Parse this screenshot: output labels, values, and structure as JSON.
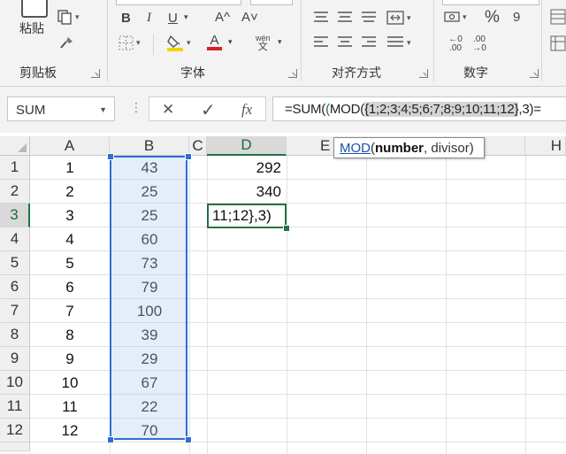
{
  "ribbon": {
    "clipboard_label": "剪贴板",
    "paste_label": "粘贴",
    "font_group_label": "字体",
    "alignment_group_label": "对齐方式",
    "number_group_label": "数字",
    "bold": "B",
    "italic": "I",
    "underline": "U",
    "grow_font": "A^",
    "shrink_font": "A˅",
    "percent": "%",
    "comma": "9",
    "wen": "wén",
    "wen_char": "文",
    "font_color": "A",
    "inc_decimal": "←0 .00",
    "dec_decimal": ".00 →0"
  },
  "formula_bar": {
    "name_box": "SUM",
    "cancel": "✕",
    "enter": "✓",
    "fx": "fx",
    "formula_prefix": "=SUM(",
    "formula_p1": "(",
    "formula_mod": "MOD(",
    "formula_array": "{1;2;3;4;5;6;7;8;9;10;11;12}",
    "formula_suffix": ",3)="
  },
  "grid": {
    "columns": [
      "A",
      "B",
      "C",
      "D",
      "E",
      "H"
    ],
    "rows": [
      "1",
      "2",
      "3",
      "4",
      "5",
      "6",
      "7",
      "8",
      "9",
      "10",
      "11",
      "12"
    ],
    "col_a": [
      "1",
      "2",
      "3",
      "4",
      "5",
      "6",
      "7",
      "8",
      "9",
      "10",
      "11",
      "12"
    ],
    "col_b": [
      "43",
      "25",
      "25",
      "60",
      "73",
      "79",
      "100",
      "39",
      "29",
      "67",
      "22",
      "70"
    ],
    "d1": "292",
    "d2": "340",
    "d3_edit": "11;12},3)"
  },
  "tooltip": {
    "function": "MOD",
    "open": "(",
    "arg1": "number",
    "rest": ", divisor)"
  },
  "colors": {
    "accent_green": "#217346",
    "selection_blue": "#2e6fd0"
  }
}
